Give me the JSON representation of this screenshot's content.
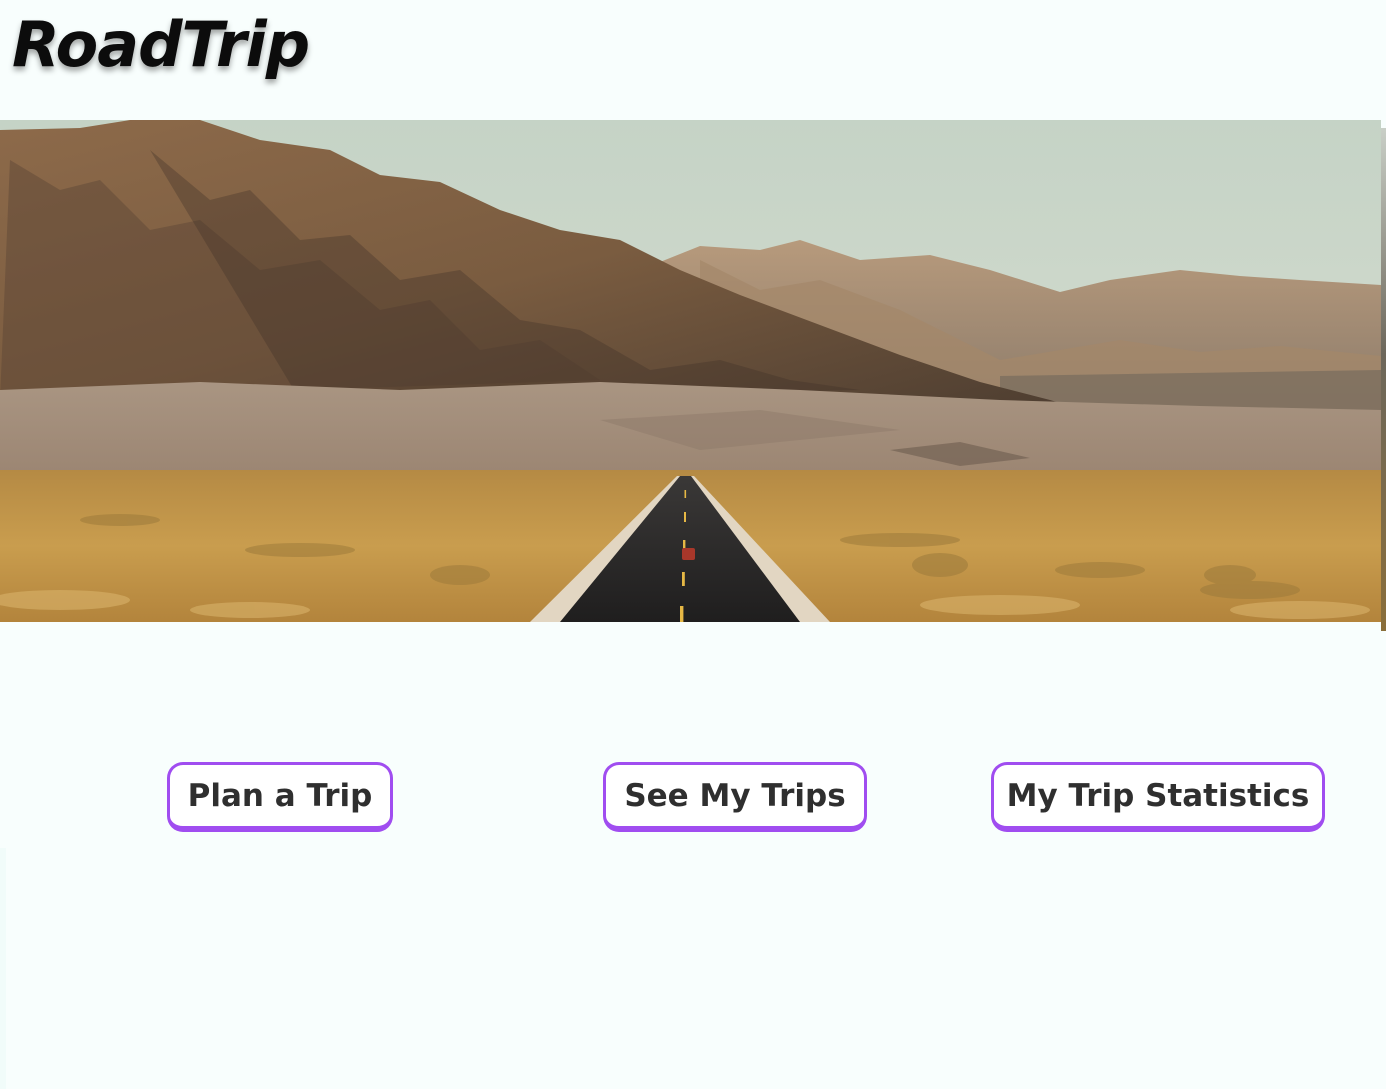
{
  "app": {
    "title": "RoadTrip"
  },
  "hero": {
    "image": "desert-road-mountains"
  },
  "actions": {
    "plan_trip": "Plan a Trip",
    "see_trips": "See My Trips",
    "statistics": "My Trip Statistics"
  },
  "colors": {
    "background": "#f8fefd",
    "button_border": "#a04df0",
    "button_text": "#2f2f2f",
    "title_text": "#0c0c0c"
  }
}
